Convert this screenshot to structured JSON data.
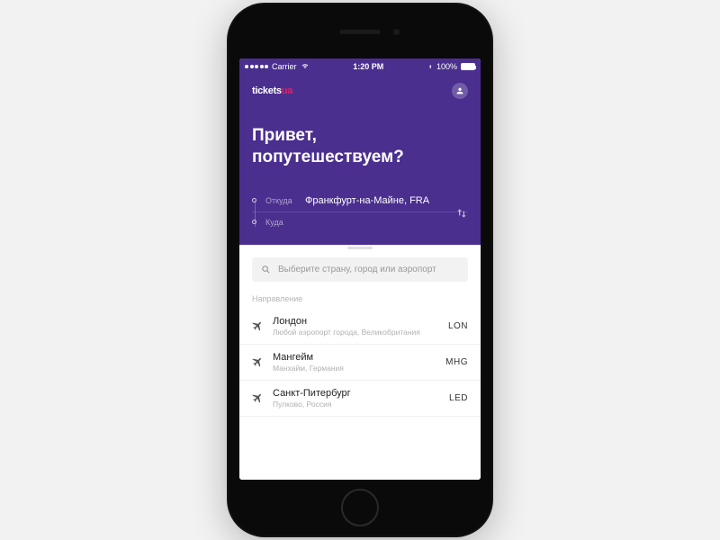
{
  "statusbar": {
    "carrier": "Carrier",
    "time": "1:20 PM",
    "battery": "100%"
  },
  "header": {
    "logo_prefix": "tickets",
    "logo_suffix": "ua"
  },
  "greeting": {
    "line1": "Привет,",
    "line2": "попутешествуем?"
  },
  "route": {
    "from_label": "Откуда",
    "from_value": "Франкфурт-на-Майне, FRA",
    "to_label": "Куда",
    "to_value": ""
  },
  "search": {
    "placeholder": "Выберите страну, город или аэропорт"
  },
  "section_title": "Направление",
  "destinations": [
    {
      "city": "Лондон",
      "sub": "Любой аэропорт города, Великобритания",
      "code": "LON"
    },
    {
      "city": "Мангейм",
      "sub": "Манхайм, Германия",
      "code": "MHG"
    },
    {
      "city": "Санкт-Питербург",
      "sub": "Пулково, Россия",
      "code": "LED"
    }
  ]
}
